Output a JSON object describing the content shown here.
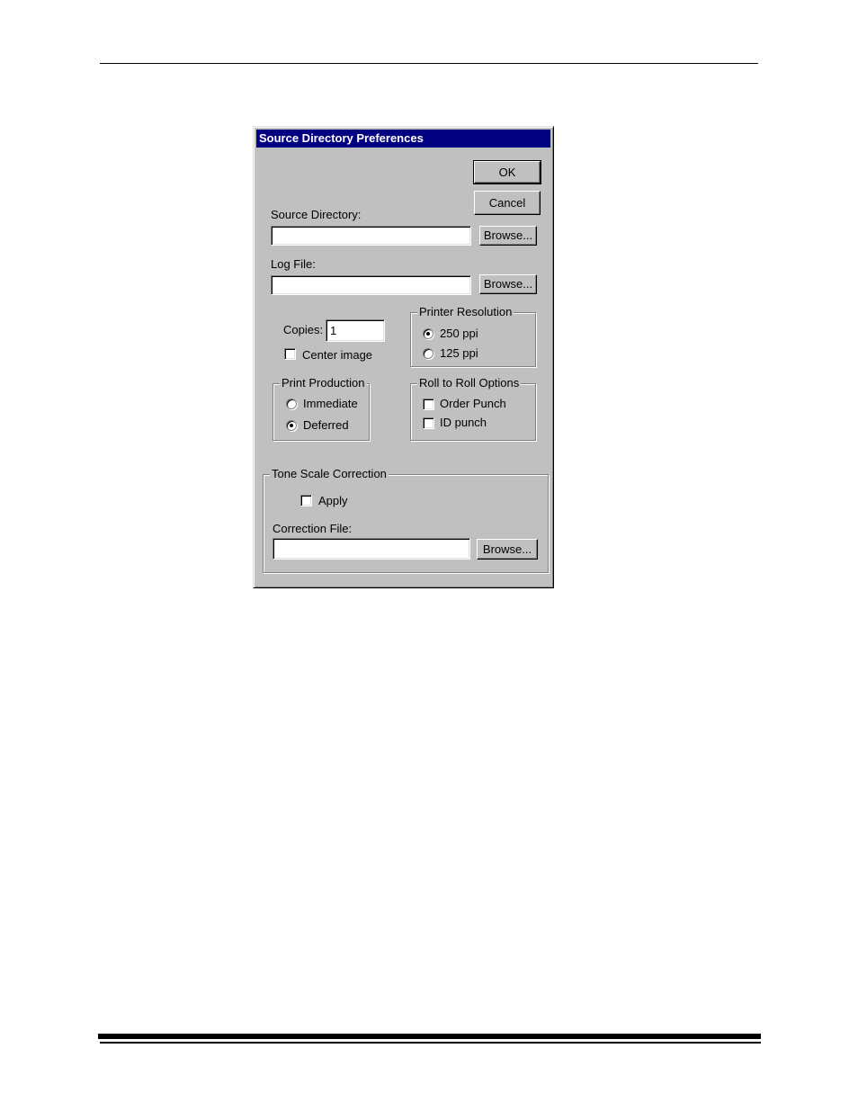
{
  "dialog": {
    "title": "Source Directory Preferences",
    "ok_label": "OK",
    "cancel_label": "Cancel",
    "source_directory": {
      "label": "Source Directory:",
      "value": "",
      "browse_label": "Browse..."
    },
    "log_file": {
      "label": "Log File:",
      "value": "",
      "browse_label": "Browse..."
    },
    "copies": {
      "label": "Copies:",
      "value": "1"
    },
    "center_image": {
      "label": "Center image",
      "checked": false
    },
    "printer_resolution": {
      "title": "Printer Resolution",
      "options": [
        {
          "label": "250 ppi",
          "selected": true
        },
        {
          "label": "125 ppi",
          "selected": false
        }
      ]
    },
    "print_production": {
      "title": "Print Production",
      "options": [
        {
          "label": "Immediate",
          "selected": false
        },
        {
          "label": "Deferred",
          "selected": true
        }
      ]
    },
    "roll_to_roll": {
      "title": "Roll to Roll Options",
      "options": [
        {
          "label": "Order Punch",
          "checked": false
        },
        {
          "label": "ID punch",
          "checked": false
        }
      ]
    },
    "tone_scale": {
      "title": "Tone Scale Correction",
      "apply_label": "Apply",
      "apply_checked": false,
      "correction_file_label": "Correction File:",
      "correction_file_value": "",
      "browse_label": "Browse..."
    }
  }
}
